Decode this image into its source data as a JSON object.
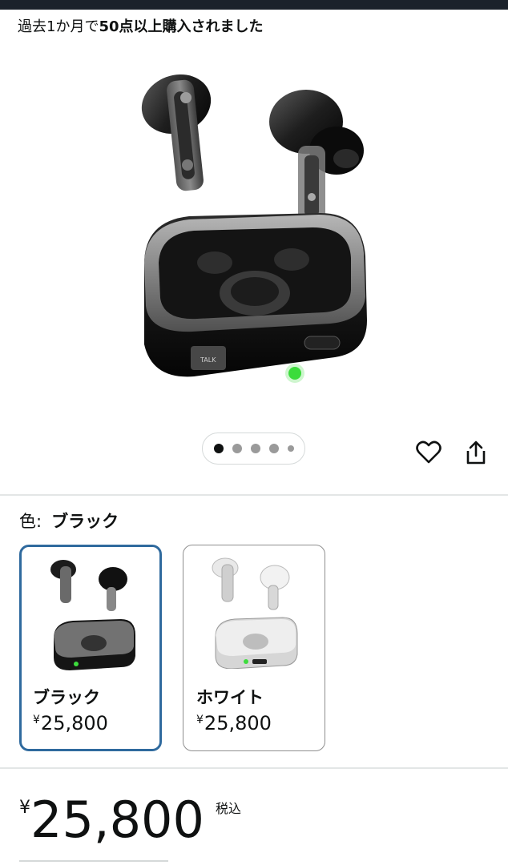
{
  "header": {
    "purchase_prefix": "過去1か月で",
    "purchase_highlight": "50点以上購入されました"
  },
  "gallery": {
    "dot_count": 5,
    "active_index": 0
  },
  "actions": {
    "favorite_icon": "heart-icon",
    "share_icon": "share-icon"
  },
  "color": {
    "label": "色:",
    "selected": "ブラック",
    "options": [
      {
        "name": "ブラック",
        "currency": "¥",
        "price": "25,800",
        "selected": true
      },
      {
        "name": "ホワイト",
        "currency": "¥",
        "price": "25,800",
        "selected": false
      }
    ]
  },
  "price": {
    "currency": "¥",
    "amount": "25,800",
    "tax_note": "税込"
  },
  "colors": {
    "selected_border": "#2f6a9e",
    "led": "#3ddc3d",
    "topbar": "#1b222b"
  }
}
